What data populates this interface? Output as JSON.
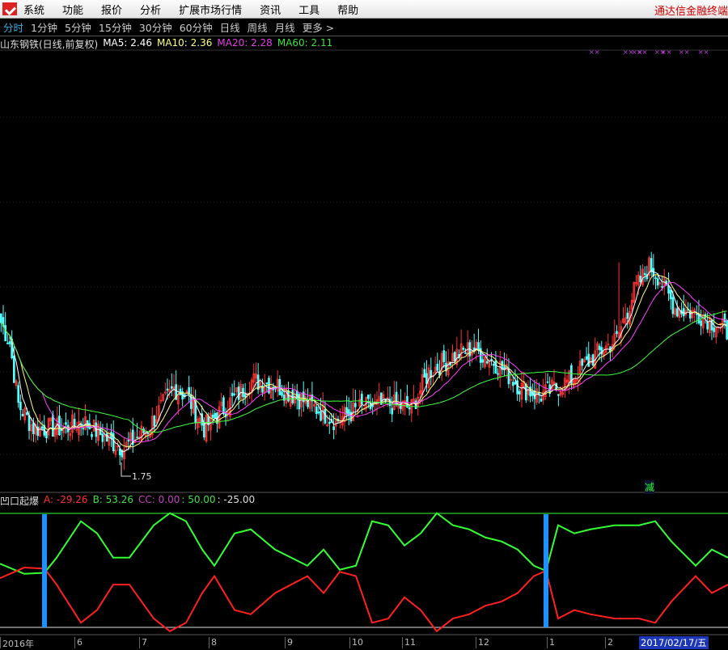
{
  "menu": {
    "items": [
      "系统",
      "功能",
      "报价",
      "分析",
      "扩展市场行情",
      "资讯",
      "工具",
      "帮助"
    ],
    "brand": "通达信金融终端"
  },
  "periods": [
    "分时",
    "1分钟",
    "5分钟",
    "15分钟",
    "30分钟",
    "60分钟",
    "日线",
    "周线",
    "月线",
    "更多 >"
  ],
  "info": {
    "title": "山东钢铁(日线,前复权)",
    "ma5": "MA5: 2.46",
    "ma10": "MA10: 2.36",
    "ma20": "MA20: 2.28",
    "ma60": "MA60: 2.11"
  },
  "colors": {
    "up": "#ff3232",
    "down": "#54ffff",
    "ma5": "#ffffff",
    "ma10": "#ffff80",
    "ma20": "#ff40ff",
    "ma60": "#40ff40",
    "osc_green": "#33ff33",
    "osc_red": "#ff2020",
    "marker": "#1e90ff"
  },
  "price_path": [
    [
      0,
      2.51
    ],
    [
      4,
      2.4
    ],
    [
      8,
      2.06
    ],
    [
      15,
      1.93
    ],
    [
      30,
      1.93
    ],
    [
      38,
      1.97
    ],
    [
      50,
      1.86
    ],
    [
      57,
      1.82
    ],
    [
      68,
      1.93
    ],
    [
      80,
      2.15
    ],
    [
      86,
      2.11
    ],
    [
      94,
      1.93
    ],
    [
      105,
      2.06
    ],
    [
      116,
      2.19
    ],
    [
      127,
      2.17
    ],
    [
      143,
      2.06
    ],
    [
      155,
      1.97
    ],
    [
      166,
      2.04
    ],
    [
      180,
      2.06
    ],
    [
      190,
      2.04
    ],
    [
      198,
      2.24
    ],
    [
      210,
      2.33
    ],
    [
      218,
      2.37
    ],
    [
      230,
      2.28
    ],
    [
      241,
      2.15
    ],
    [
      250,
      2.11
    ],
    [
      263,
      2.19
    ],
    [
      275,
      2.33
    ],
    [
      285,
      2.42
    ],
    [
      293,
      2.68
    ],
    [
      300,
      2.82
    ],
    [
      304,
      2.77
    ],
    [
      312,
      2.59
    ],
    [
      325,
      2.55
    ],
    [
      336,
      2.46
    ]
  ],
  "low_label": "1.75",
  "signal_label": "减",
  "indicator": {
    "name": "凹口起爆",
    "a": "A: -29.26",
    "b": "B: 53.26",
    "cc": "CC: 0.00",
    "l50": ": 50.00",
    "lm25": ": -25.00",
    "green": [
      [
        0,
        7
      ],
      [
        6,
        -3
      ],
      [
        11,
        -2
      ],
      [
        14,
        13
      ],
      [
        20,
        49
      ],
      [
        24,
        37
      ],
      [
        28,
        13
      ],
      [
        32,
        13
      ],
      [
        38,
        45
      ],
      [
        42,
        57
      ],
      [
        46,
        49
      ],
      [
        50,
        21
      ],
      [
        53,
        5
      ],
      [
        58,
        37
      ],
      [
        62,
        41
      ],
      [
        68,
        21
      ],
      [
        72,
        13
      ],
      [
        76,
        5
      ],
      [
        80,
        21
      ],
      [
        84,
        1
      ],
      [
        88,
        5
      ],
      [
        92,
        49
      ],
      [
        96,
        45
      ],
      [
        100,
        25
      ],
      [
        104,
        37
      ],
      [
        108,
        57
      ],
      [
        112,
        45
      ],
      [
        116,
        41
      ],
      [
        120,
        33
      ],
      [
        124,
        29
      ],
      [
        128,
        21
      ],
      [
        132,
        5
      ],
      [
        135,
        0
      ],
      [
        138,
        45
      ],
      [
        142,
        37
      ],
      [
        146,
        41
      ],
      [
        152,
        45
      ],
      [
        158,
        45
      ],
      [
        162,
        49
      ],
      [
        166,
        29
      ],
      [
        172,
        5
      ],
      [
        176,
        21
      ],
      [
        180,
        13
      ]
    ],
    "markers": [
      11,
      135
    ]
  },
  "xaxis": {
    "labels": [
      [
        "2016年",
        0
      ],
      [
        "6",
        92
      ],
      [
        "7",
        172
      ],
      [
        "8",
        258
      ],
      [
        "9",
        352
      ],
      [
        "10",
        432
      ],
      [
        "11",
        497
      ],
      [
        "12",
        588
      ],
      [
        "1",
        676
      ],
      [
        "2",
        748
      ]
    ],
    "current": "2017/02/17/五"
  }
}
